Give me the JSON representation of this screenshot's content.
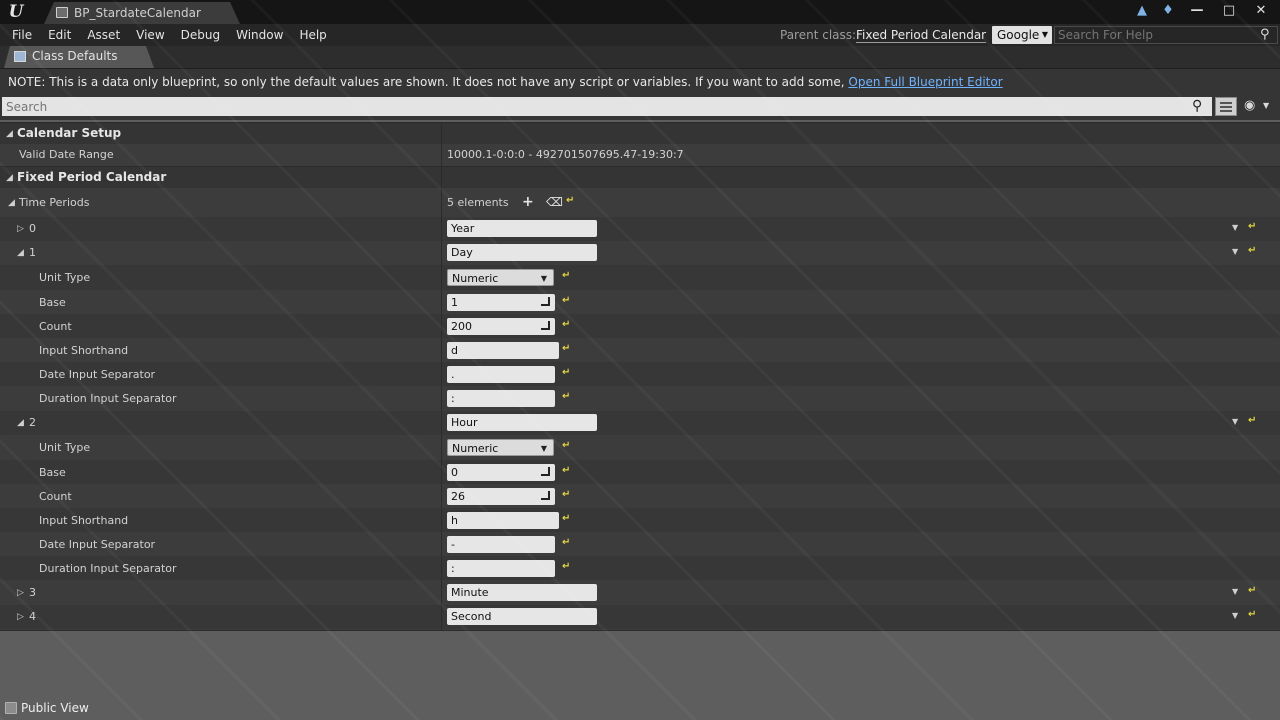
{
  "window": {
    "tab_title": "BP_StardateCalendar"
  },
  "menu": {
    "items": [
      "File",
      "Edit",
      "Asset",
      "View",
      "Debug",
      "Window",
      "Help"
    ]
  },
  "header": {
    "parent_class_label": "Parent class:",
    "parent_class_value": "Fixed Period Calendar",
    "search_provider": "Google",
    "help_search_placeholder": "Search For Help"
  },
  "panel": {
    "tab_label": "Class Defaults"
  },
  "note": {
    "text": "NOTE: This is a data only blueprint, so only the default values are shown.  It does not have any script or variables.  If you want to add some,",
    "link": "Open Full Blueprint Editor"
  },
  "details": {
    "search_placeholder": "Search",
    "calendar_setup": {
      "title": "Calendar Setup",
      "valid_date_range_label": "Valid Date Range",
      "valid_date_range_value": "10000.1-0:0:0 - 492701507695.47-19:30:7"
    },
    "fixed_period_calendar": {
      "title": "Fixed Period Calendar",
      "time_periods_label": "Time Periods",
      "elements_count": "5 elements",
      "periods": [
        {
          "index": "0",
          "name": "Year"
        },
        {
          "index": "1",
          "name": "Day",
          "unit_type_label": "Unit Type",
          "unit_type": "Numeric",
          "base_label": "Base",
          "base": "1",
          "count_label": "Count",
          "count": "200",
          "input_shorthand_label": "Input Shorthand",
          "input_shorthand": "d",
          "date_sep_label": "Date Input Separator",
          "date_sep": ".",
          "duration_sep_label": "Duration Input Separator",
          "duration_sep": ":"
        },
        {
          "index": "2",
          "name": "Hour",
          "unit_type_label": "Unit Type",
          "unit_type": "Numeric",
          "base_label": "Base",
          "base": "0",
          "count_label": "Count",
          "count": "26",
          "input_shorthand_label": "Input Shorthand",
          "input_shorthand": "h",
          "date_sep_label": "Date Input Separator",
          "date_sep": "-",
          "duration_sep_label": "Duration Input Separator",
          "duration_sep": ":"
        },
        {
          "index": "3",
          "name": "Minute"
        },
        {
          "index": "4",
          "name": "Second"
        }
      ]
    }
  },
  "footer": {
    "public_view_label": "Public View"
  }
}
